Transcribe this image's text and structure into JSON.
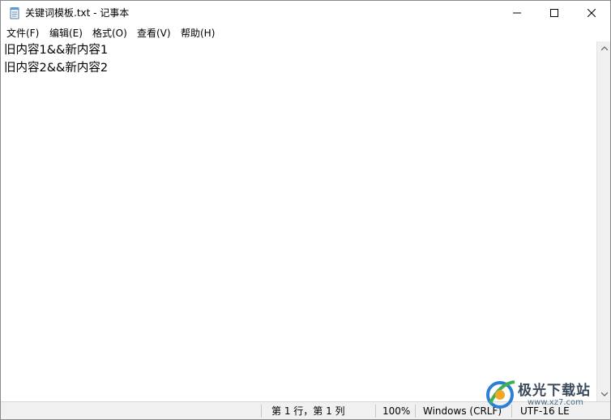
{
  "window": {
    "title": "关键词模板.txt - 记事本"
  },
  "menu": {
    "items": [
      {
        "label": "文件(F)"
      },
      {
        "label": "编辑(E)"
      },
      {
        "label": "格式(O)"
      },
      {
        "label": "查看(V)"
      },
      {
        "label": "帮助(H)"
      }
    ]
  },
  "editor": {
    "lines": [
      "旧内容1&&新内容1",
      "旧内容2&&新内容2"
    ]
  },
  "status": {
    "position": "第 1 行，第 1 列",
    "zoom": "100%",
    "line_ending": "Windows (CRLF)",
    "encoding": "UTF-16 LE"
  },
  "watermark": {
    "logo_text": "极光下载站",
    "url": "www.xz7.com"
  },
  "colors": {
    "statusbar_bg": "#f0f0f0",
    "scrollbar_bg": "#f0f0f0"
  }
}
